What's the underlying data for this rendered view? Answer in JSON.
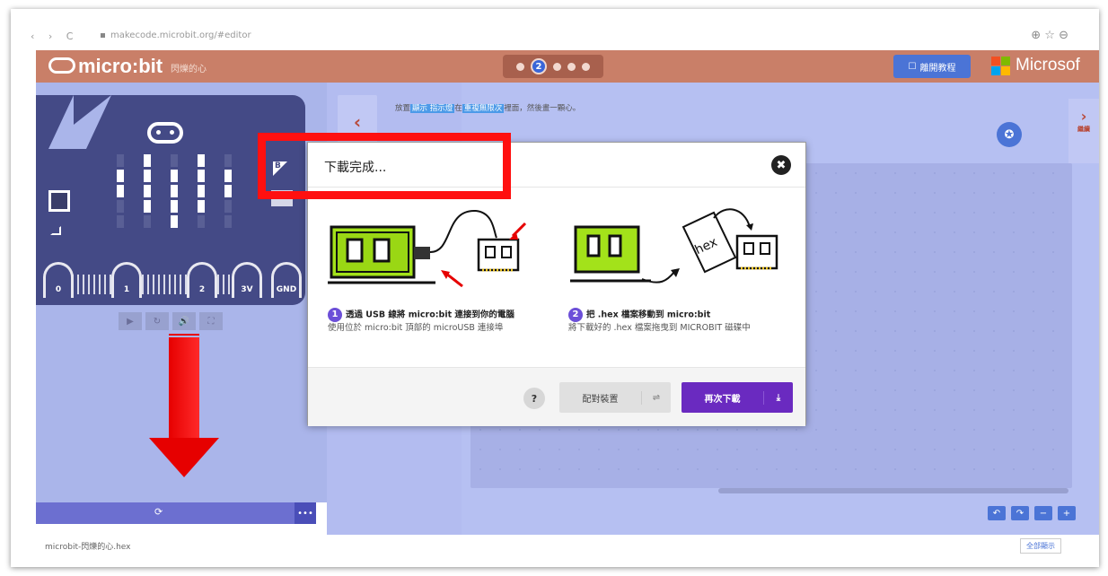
{
  "browser": {
    "nav": "‹ › C",
    "url": "makecode.microbit.org/#editor",
    "icons": "⊕ ☆ ⊖"
  },
  "header": {
    "logo": "micro:bit",
    "project_name": "閃爍的心",
    "step_current": "2",
    "exit_tutorial": "離開教程",
    "brand": "Microsof"
  },
  "instruction": {
    "prefix": "放置",
    "block1": "顯示 指示燈",
    "middle": "在",
    "block2": "重複無限次",
    "suffix": "裡面，然後畫一顆心。"
  },
  "next_step_label": "繼續",
  "simulator": {
    "pins": [
      "0",
      "1",
      "2",
      "3V",
      "GND"
    ],
    "label_b": "B",
    "controls": [
      "▶",
      "↻",
      "🔊",
      "⛶"
    ],
    "led_grid": [
      [
        0,
        1,
        0,
        1,
        0
      ],
      [
        1,
        1,
        1,
        1,
        1
      ],
      [
        1,
        1,
        1,
        1,
        1
      ],
      [
        0,
        1,
        1,
        1,
        0
      ],
      [
        0,
        0,
        1,
        0,
        0
      ]
    ]
  },
  "download_bar": {
    "label": "⟳",
    "more": "•••"
  },
  "shelf": {
    "file": "microbit-閃爍的心.hex",
    "show_all": "全部顯示"
  },
  "dialog": {
    "title": "下載完成...",
    "close": "✖",
    "step1": {
      "num": "1",
      "title": "透過 USB 線將 micro:bit 連接到你的電腦",
      "desc": "使用位於 micro:bit 頂部的 microUSB 連接埠"
    },
    "step2": {
      "num": "2",
      "title": "把 .hex 檔案移動到 micro:bit",
      "desc": "將下載好的 .hex 檔案拖曳到 MICROBIT 磁碟中"
    },
    "help": "?",
    "pair_label": "配對裝置",
    "pair_icon": "⇌",
    "redownload_label": "再次下載",
    "redownload_icon": "⤓",
    "hex_label": "hex"
  },
  "colors": {
    "header": "#c97f68",
    "accent_purple": "#6a2ac0",
    "highlight_red": "#ff1010",
    "board": "#444a86"
  }
}
